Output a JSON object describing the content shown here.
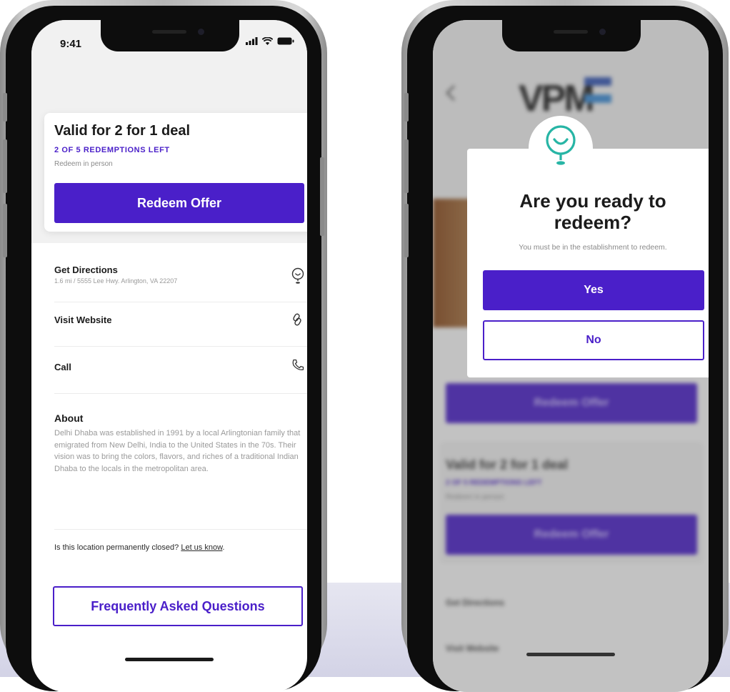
{
  "left_screen": {
    "status_time": "9:41",
    "offer": {
      "title": "Valid for 2 for 1 deal",
      "redemptions": "2 OF 5 REDEMPTIONS LEFT",
      "subtitle": "Redeem in person",
      "button": "Redeem Offer"
    },
    "directions": {
      "title": "Get Directions",
      "address": "1.6 mi / 5555 Lee Hwy. Arlington, VA 22207"
    },
    "website": "Visit Website",
    "call": "Call",
    "about": {
      "title": "About",
      "text": "Delhi Dhaba was established in 1991 by a local Arlingtonian family that emigrated from New Delhi, India to the United States in the 70s. Their vision was to bring the colors, flavors, and riches of a traditional Indian Dhaba to the locals in the metropolitan area."
    },
    "closed": {
      "question": "Is this location permanently closed?",
      "link": "Let us know"
    },
    "faq_button": "Frequently Asked Questions"
  },
  "right_screen": {
    "modal": {
      "title": "Are you ready to redeem?",
      "subtitle": "You must be in the establishment to redeem.",
      "yes": "Yes",
      "no": "No"
    },
    "background": {
      "logo": "VPM",
      "redeem_button": "Redeem Offer",
      "offer_title": "Valid for 2 for 1 deal",
      "redemptions": "2 OF 5 REDEMPTIONS LEFT",
      "subtitle": "Redeem in person",
      "directions": "Get Directions",
      "website": "Visit Website"
    }
  },
  "colors": {
    "accent": "#4a1fc9",
    "teal_icon": "#27b5a5"
  },
  "icons": [
    "location-pin-icon",
    "link-icon",
    "phone-icon",
    "back-chevron-icon",
    "signal-icon",
    "wifi-icon",
    "battery-icon"
  ]
}
